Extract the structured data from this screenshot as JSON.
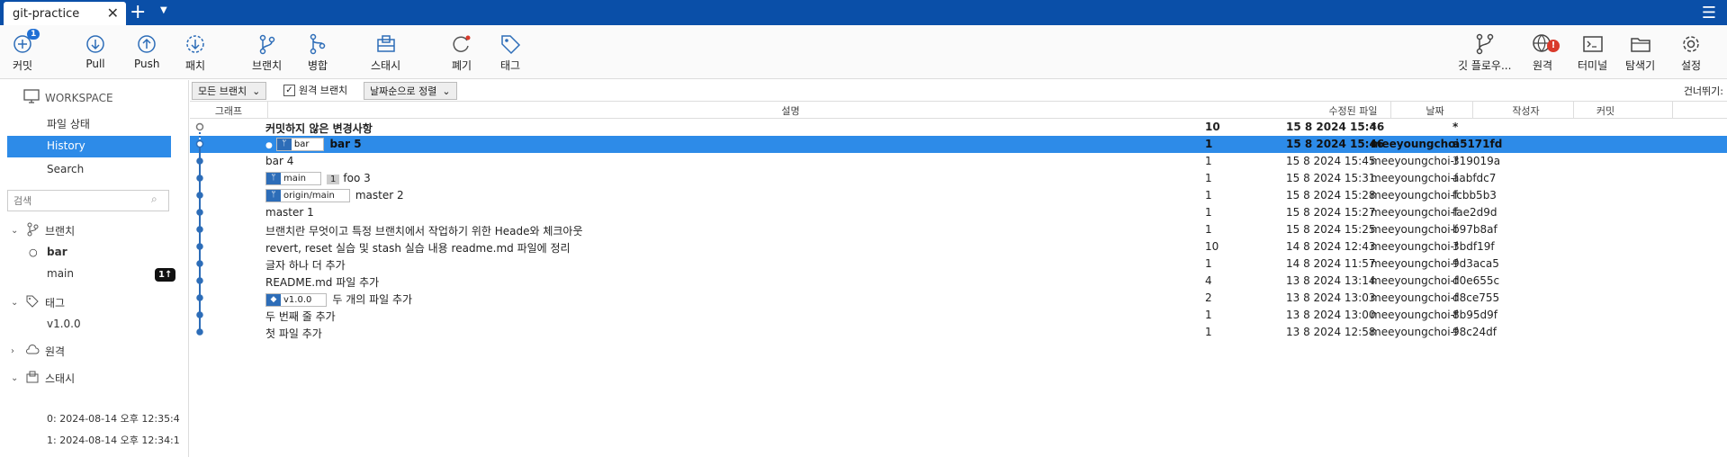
{
  "tab": {
    "title": "git-practice",
    "close": "✕",
    "plus": "+",
    "menu": "☰"
  },
  "toolbar": {
    "commit": {
      "label": "커밋",
      "badge": "1"
    },
    "pull": "Pull",
    "push": "Push",
    "fetch": "패치",
    "branch": "브랜치",
    "merge": "병합",
    "stash": "스태시",
    "discard": "폐기",
    "tag": "태그",
    "gitflow": "깃 플로우...",
    "remote": {
      "label": "원격",
      "badge": "!"
    },
    "terminal": "터미널",
    "explorer": "탐색기",
    "settings": "설정"
  },
  "sidebar": {
    "workspace": "WORKSPACE",
    "file_status": "파일 상태",
    "history": "History",
    "search": "Search",
    "search_placeholder": "검색",
    "branches_title": "브랜치",
    "branches": [
      {
        "name": "bar",
        "current": true,
        "count": ""
      },
      {
        "name": "main",
        "current": false,
        "count": "1↑"
      }
    ],
    "tags_title": "태그",
    "tags": [
      "v1.0.0"
    ],
    "remotes_title": "원격",
    "stashes_title": "스태시",
    "stashes": [
      "0: 2024-08-14 오후 12:35:4",
      "1: 2024-08-14 오후 12:34:1"
    ]
  },
  "filter": {
    "branches": "모든 브랜치",
    "remote_branches": "원격 브랜치",
    "sort": "날짜순으로 정렬",
    "skip": "건너뛰기:"
  },
  "columns": {
    "graph": "그래프",
    "desc": "설명",
    "files": "수정된 파일",
    "date": "날짜",
    "author": "작성자",
    "commit": "커밋"
  },
  "rows": [
    {
      "desc": "커밋하지 않은 변경사항",
      "files": "10",
      "date": "15 8 2024 15:46",
      "author": "*",
      "hash": "*",
      "refs": []
    },
    {
      "desc": "bar 5",
      "files": "1",
      "date": "15 8 2024 15:46",
      "author": "meeyoungchoi-fr",
      "hash": "a5171fd",
      "refs": [
        {
          "name": "bar",
          "head": true
        }
      ]
    },
    {
      "desc": "bar 4",
      "files": "1",
      "date": "15 8 2024 15:45",
      "author": "meeyoungchoi-frc",
      "hash": "319019a",
      "refs": []
    },
    {
      "desc": "foo 3",
      "files": "1",
      "date": "15 8 2024 15:31",
      "author": "meeyoungchoi-frc",
      "hash": "aabfdc7",
      "refs": [
        {
          "name": "main",
          "ahead": "1"
        }
      ]
    },
    {
      "desc": "master 2",
      "files": "1",
      "date": "15 8 2024 15:28",
      "author": "meeyoungchoi-frc",
      "hash": "fcbb5b3",
      "refs": [
        {
          "name": "origin/main"
        }
      ]
    },
    {
      "desc": "master 1",
      "files": "1",
      "date": "15 8 2024 15:27",
      "author": "meeyoungchoi-frc",
      "hash": "fae2d9d",
      "refs": []
    },
    {
      "desc": "브랜치란 무엇이고 특정 브랜치에서 작업하기 위한 Heade와 체크아웃",
      "files": "1",
      "date": "15 8 2024 15:25",
      "author": "meeyoungchoi-frc",
      "hash": "b97b8af",
      "refs": []
    },
    {
      "desc": "revert, reset 실습 및 stash 실습 내용 readme.md 파일에 정리",
      "files": "10",
      "date": "14 8 2024 12:43",
      "author": "meeyoungchoi-frc",
      "hash": "3bdf19f",
      "refs": []
    },
    {
      "desc": "글자 하나 더 추가",
      "files": "1",
      "date": "14 8 2024 11:57",
      "author": "meeyoungchoi-frc",
      "hash": "9d3aca5",
      "refs": []
    },
    {
      "desc": "README.md 파일 추가",
      "files": "4",
      "date": "13 8 2024 13:14",
      "author": "meeyoungchoi-frc",
      "hash": "d0e655c",
      "refs": []
    },
    {
      "desc": "두 개의 파일 추가",
      "files": "2",
      "date": "13 8 2024 13:03",
      "author": "meeyoungchoi-frc",
      "hash": "d8ce755",
      "refs": [
        {
          "name": "v1.0.0",
          "tag": true
        }
      ]
    },
    {
      "desc": "두 번째 줄 추가",
      "files": "1",
      "date": "13 8 2024 13:00",
      "author": "meeyoungchoi-frc",
      "hash": "8b95d9f",
      "refs": []
    },
    {
      "desc": "첫 파일 추가",
      "files": "1",
      "date": "13 8 2024 12:58",
      "author": "meeyoungchoi-frc",
      "hash": "98c24df",
      "refs": []
    }
  ],
  "colors": {
    "accent": "#2d8be8",
    "titlebar": "#0a4fa8",
    "graph": "#2d6db8"
  }
}
